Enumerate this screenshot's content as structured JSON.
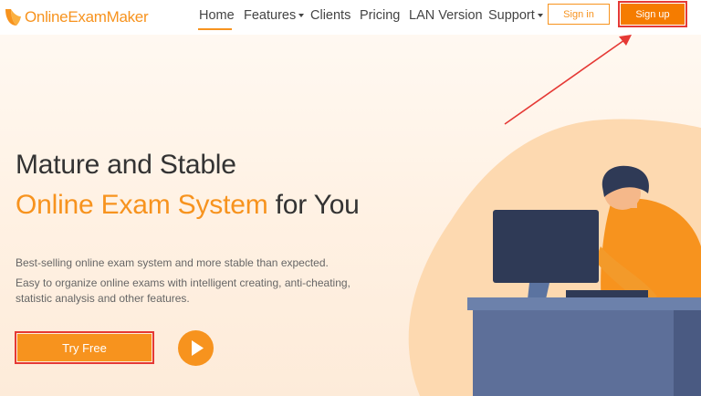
{
  "brand": {
    "name": "OnlineExamMaker",
    "accent_color": "#f7931e",
    "logo_icon": "quill-logo-icon"
  },
  "nav": {
    "items": [
      {
        "label": "Home",
        "active": true,
        "dropdown": false
      },
      {
        "label": "Features",
        "active": false,
        "dropdown": true
      },
      {
        "label": "Clients",
        "active": false,
        "dropdown": false
      },
      {
        "label": "Pricing",
        "active": false,
        "dropdown": false
      },
      {
        "label": "LAN Version",
        "active": false,
        "dropdown": false
      },
      {
        "label": "Support",
        "active": false,
        "dropdown": true
      }
    ],
    "signin_label": "Sign in",
    "signup_label": "Sign up"
  },
  "hero": {
    "title_line1": "Mature and Stable",
    "title_line2_accent": "Online Exam System",
    "title_line2_rest": " for You",
    "paragraph1": "Best-selling online exam system and more stable than expected.",
    "paragraph2": "Easy to organize online exams with intelligent creating, anti-cheating, statistic analysis and other features.",
    "cta_label": "Try Free",
    "play_icon": "play-icon"
  },
  "annotation": {
    "highlight_color": "#e53935"
  },
  "illustration": {
    "subject": "person-at-computer-illustration"
  }
}
